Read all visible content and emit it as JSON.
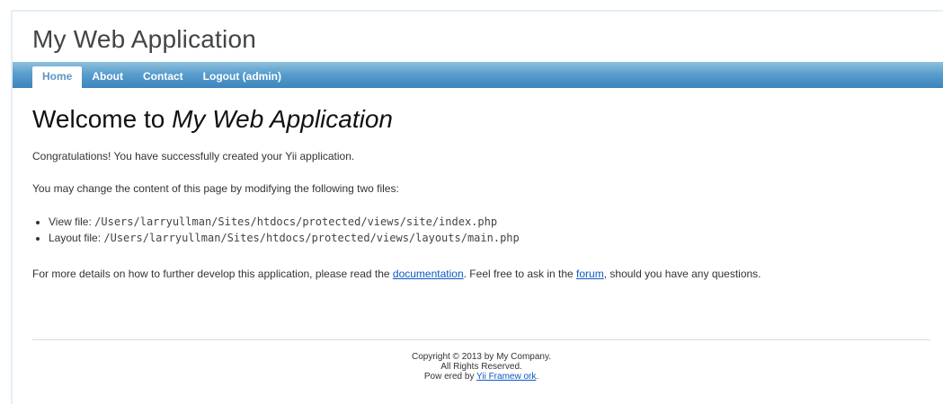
{
  "header": {
    "title": "My Web Application"
  },
  "menu": {
    "items": [
      {
        "label": "Home",
        "active": true
      },
      {
        "label": "About",
        "active": false
      },
      {
        "label": "Contact",
        "active": false
      },
      {
        "label": "Logout (admin)",
        "active": false
      }
    ]
  },
  "main": {
    "heading_prefix": "Welcome to ",
    "heading_emphasis": "My Web Application",
    "congrats": "Congratulations! You have successfully created your Yii application.",
    "change_text": "You may change the content of this page by modifying the following two files:",
    "files": [
      {
        "label": "View file: ",
        "path": "/Users/larryullman/Sites/htdocs/protected/views/site/index.php"
      },
      {
        "label": "Layout file: ",
        "path": "/Users/larryullman/Sites/htdocs/protected/views/layouts/main.php"
      }
    ],
    "details_before": "For more details on how to further develop this application, please read the ",
    "documentation_link": "documentation",
    "details_middle": ". Feel free to ask in the ",
    "forum_link": "forum",
    "details_after": ", should you have any questions."
  },
  "footer": {
    "copyright": "Copyright © 2013 by My Company.",
    "rights": "All Rights Reserved.",
    "powered_prefix": "Pow ered by ",
    "powered_link": "Yii Framew ork",
    "powered_suffix": "."
  },
  "colors": {
    "menu_gradient_top": "#8fc0de",
    "menu_gradient_bottom": "#3b84bc",
    "active_menu_text": "#5f94c4",
    "link": "#0b58c4"
  }
}
